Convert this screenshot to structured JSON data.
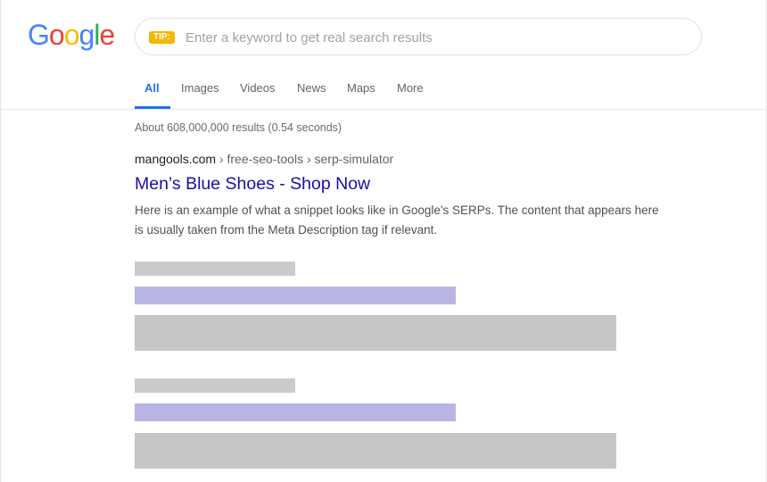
{
  "logo": {
    "letters": [
      {
        "char": "G",
        "color": "#4285F4"
      },
      {
        "char": "o",
        "color": "#EA4335"
      },
      {
        "char": "o",
        "color": "#FBBC05"
      },
      {
        "char": "g",
        "color": "#4285F4"
      },
      {
        "char": "l",
        "color": "#34A853"
      },
      {
        "char": "e",
        "color": "#EA4335"
      }
    ]
  },
  "search": {
    "tip_label": "TIP:",
    "placeholder": "Enter a keyword to get real search results"
  },
  "tabs": [
    {
      "label": "All",
      "active": true
    },
    {
      "label": "Images",
      "active": false
    },
    {
      "label": "Videos",
      "active": false
    },
    {
      "label": "News",
      "active": false
    },
    {
      "label": "Maps",
      "active": false
    },
    {
      "label": "More",
      "active": false
    }
  ],
  "results": {
    "stats": "About 608,000,000 results (0.54 seconds)",
    "first": {
      "domain": "mangools.com",
      "path": " › free-seo-tools › serp-simulator",
      "title": "Men’s Blue Shoes - Shop Now",
      "snippet": "Here is an example of what a snippet looks like in Google's SERPs. The content that appears here is usually taken from the Meta Description tag if relevant."
    }
  },
  "colors": {
    "accent": "#1a73e8",
    "link": "#1a0dab",
    "tip_badge": "#f7b500",
    "placeholder_url": "#cbcbcb",
    "placeholder_title": "#b9b5e3",
    "placeholder_snippet": "#c6c6c6"
  }
}
